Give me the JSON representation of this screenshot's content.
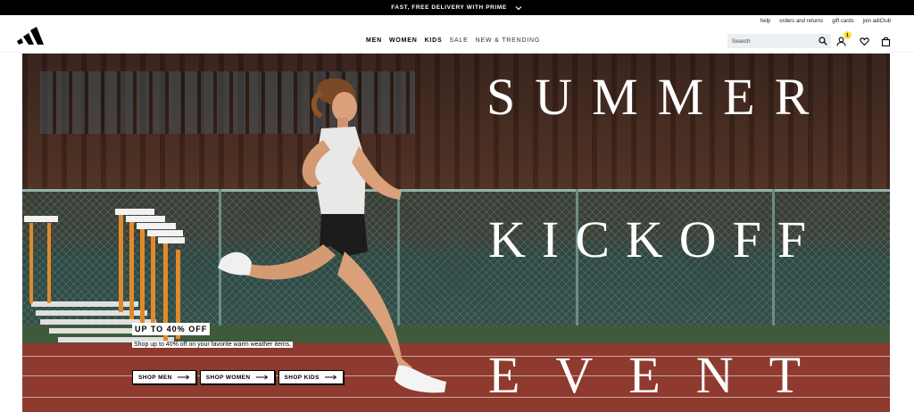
{
  "promo": {
    "text": "FAST, FREE DELIVERY WITH PRIME",
    "chevron_icon": "chevron-down-icon"
  },
  "header": {
    "logo": "adidas-logo",
    "util_links": [
      "help",
      "orders and returns",
      "gift cards",
      "join adiClub"
    ],
    "nav": [
      {
        "label": "MEN",
        "style": "bold"
      },
      {
        "label": "WOMEN",
        "style": "bold"
      },
      {
        "label": "KIDS",
        "style": "bold"
      },
      {
        "label": "SALE",
        "style": "light"
      },
      {
        "label": "NEW & TRENDING",
        "style": "light"
      }
    ],
    "search": {
      "placeholder": "Search",
      "icon": "search-icon"
    },
    "account": {
      "icon": "user-icon",
      "badge": "1"
    },
    "wishlist_icon": "heart-icon",
    "bag_icon": "shopping-bag-icon"
  },
  "hero": {
    "title_lines": [
      "SUMMER",
      "KICKOFF",
      "EVENT"
    ],
    "sale_tag": "UP TO 40% OFF",
    "description": "Shop up to 40% off on your favorite warm weather items.",
    "ctas": [
      "SHOP MEN",
      "SHOP WOMEN",
      "SHOP KIDS"
    ],
    "cta_icon": "arrow-right-icon"
  },
  "colors": {
    "promo_bg": "#000000",
    "badge": "#f8e43a",
    "search_bg": "#eceff1",
    "track": "#8e3a2e"
  }
}
